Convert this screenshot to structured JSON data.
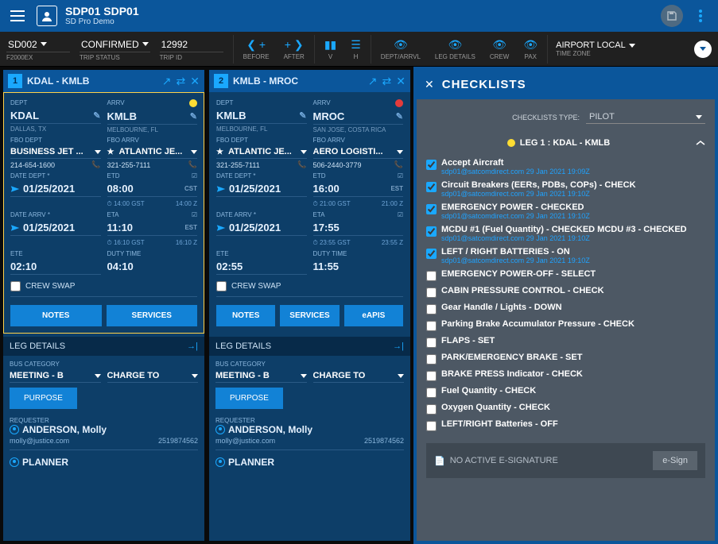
{
  "header": {
    "title": "SDP01 SDP01",
    "sub": "SD Pro Demo"
  },
  "toolbar": {
    "aircraft": {
      "val": "SD002",
      "lab": "F2000EX"
    },
    "status": {
      "val": "CONFIRMED",
      "lab": "TRIP STATUS"
    },
    "trip": {
      "val": "12992",
      "lab": "TRIP ID"
    },
    "before": "BEFORE",
    "after": "AFTER",
    "v": "V",
    "h": "H",
    "col1": "DEPT/ARRVL",
    "col2": "LEG DETAILS",
    "col3": "CREW",
    "col4": "PAX",
    "tz": {
      "val": "AIRPORT LOCAL",
      "lab": "TIME ZONE"
    }
  },
  "legs": [
    {
      "num": "1",
      "title": "KDAL - KMLB",
      "status": "yellow",
      "dept": {
        "lbl": "DEPT",
        "code": "KDAL",
        "city": "DALLAS, TX",
        "fbolbl": "FBO DEPT",
        "fbo": "BUSINESS JET ...",
        "phone": "214-654-1600"
      },
      "arrv": {
        "lbl": "ARRV",
        "code": "KMLB",
        "city": "MELBOURNE, FL",
        "fbolbl": "FBO ARRV",
        "fbo": "ATLANTIC JE...",
        "phone": "321-255-7111",
        "starred": true
      },
      "dates": {
        "deptlbl": "DATE DEPT *",
        "dept": "01/25/2021",
        "arrvlbl": "DATE ARRV *",
        "arrv": "01/25/2021",
        "etdlbl": "ETD",
        "etd": "08:00",
        "etdtz": "CST",
        "etdrow": "⏱ 14:00 GST",
        "etdrow2": "14:00 Z",
        "etalbl": "ETA",
        "eta": "11:10",
        "etatz": "EST",
        "etarow": "⏱ 16:10 GST",
        "etarow2": "16:10 Z"
      },
      "ete": {
        "lbl": "ETE",
        "val": "02:10"
      },
      "duty": {
        "lbl": "DUTY TIME",
        "val": "04:10"
      },
      "crewswap": "CREW SWAP",
      "notes": "NOTES",
      "services": "SERVICES",
      "legdet": "LEG DETAILS",
      "catlbl": "BUS CATEGORY",
      "cat": "MEETING - B",
      "charge": "CHARGE TO",
      "purpose": "PURPOSE",
      "reqlbl": "REQUESTER",
      "reqname": "ANDERSON, Molly",
      "reqemail": "molly@justice.com",
      "reqphone": "2519874562",
      "planner": "PLANNER"
    },
    {
      "num": "2",
      "title": "KMLB - MROC",
      "status": "red",
      "dept": {
        "lbl": "DEPT",
        "code": "KMLB",
        "city": "MELBOURNE, FL",
        "fbolbl": "FBO DEPT",
        "fbo": "ATLANTIC JE...",
        "phone": "321-255-7111",
        "starred": true
      },
      "arrv": {
        "lbl": "ARRV",
        "code": "MROC",
        "city": "SAN JOSE, COSTA RICA",
        "fbolbl": "FBO ARRV",
        "fbo": "AERO LOGISTI...",
        "phone": "506-2440-3779"
      },
      "dates": {
        "deptlbl": "DATE DEPT *",
        "dept": "01/25/2021",
        "arrvlbl": "DATE ARRV *",
        "arrv": "01/25/2021",
        "etdlbl": "ETD",
        "etd": "16:00",
        "etdtz": "EST",
        "etdrow": "⏱ 21:00 GST",
        "etdrow2": "21:00 Z",
        "etalbl": "ETA",
        "eta": "17:55",
        "etatz": "",
        "etarow": "⏱ 23:55 GST",
        "etarow2": "23:55 Z"
      },
      "ete": {
        "lbl": "ETE",
        "val": "02:55"
      },
      "duty": {
        "lbl": "DUTY TIME",
        "val": "11:55"
      },
      "crewswap": "CREW SWAP",
      "notes": "NOTES",
      "services": "SERVICES",
      "eapis": "eAPIS",
      "legdet": "LEG DETAILS",
      "catlbl": "BUS CATEGORY",
      "cat": "MEETING - B",
      "charge": "CHARGE TO",
      "purpose": "PURPOSE",
      "reqlbl": "REQUESTER",
      "reqname": "ANDERSON, Molly",
      "reqemail": "molly@justice.com",
      "reqphone": "2519874562",
      "planner": "PLANNER"
    }
  ],
  "panel": {
    "title": "CHECKLISTS",
    "typelbl": "CHECKLISTS TYPE:",
    "type": "PILOT",
    "leg": "LEG 1 : KDAL - KMLB",
    "meta_user": "sdp01@satcomdirect.com",
    "meta_time": "29 Jan 2021 19:10Z",
    "meta_time0": "29 Jan 2021 19:09Z",
    "items": [
      {
        "c": true,
        "t": "Accept Aircraft",
        "m": true,
        "t0": true
      },
      {
        "c": true,
        "t": "Circuit Breakers (EERs, PDBs, COPs) - CHECK",
        "m": true
      },
      {
        "c": true,
        "t": "EMERGENCY POWER - CHECKED",
        "m": true
      },
      {
        "c": true,
        "t": "MCDU #1 (Fuel Quantity) - CHECKED MCDU #3 - CHECKED",
        "m": true
      },
      {
        "c": true,
        "t": "LEFT / RIGHT BATTERIES - ON",
        "m": true
      },
      {
        "c": false,
        "t": "EMERGENCY POWER-OFF - SELECT"
      },
      {
        "c": false,
        "t": "CABIN PRESSURE CONTROL - CHECK"
      },
      {
        "c": false,
        "t": "Gear Handle / Lights - DOWN"
      },
      {
        "c": false,
        "t": "Parking Brake Accumulator Pressure - CHECK"
      },
      {
        "c": false,
        "t": "FLAPS - SET"
      },
      {
        "c": false,
        "t": "PARK/EMERGENCY BRAKE - SET"
      },
      {
        "c": false,
        "t": "BRAKE PRESS Indicator - CHECK"
      },
      {
        "c": false,
        "t": "Fuel Quantity - CHECK"
      },
      {
        "c": false,
        "t": "Oxygen Quantity - CHECK"
      },
      {
        "c": false,
        "t": "LEFT/RIGHT Batteries - OFF"
      }
    ],
    "esig": "NO ACTIVE E-SIGNATURE",
    "esignbtn": "e-Sign"
  }
}
